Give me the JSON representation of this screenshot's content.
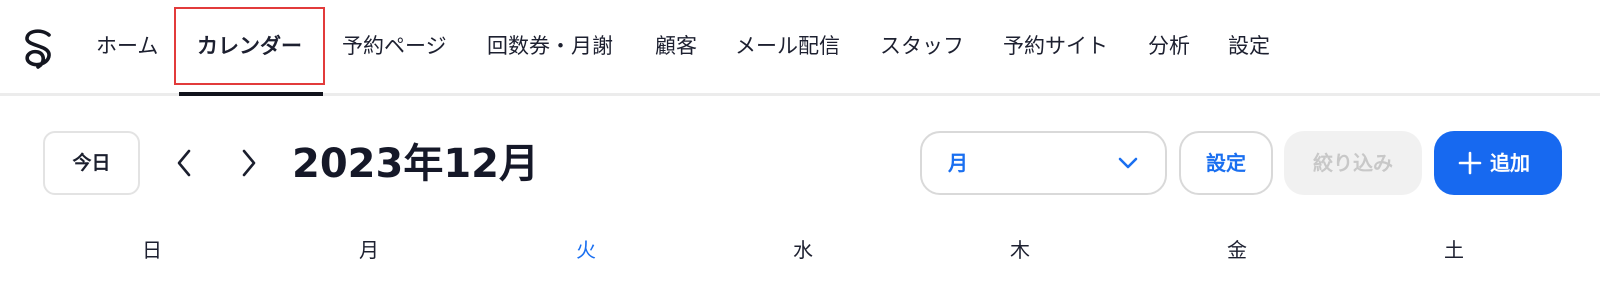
{
  "nav": {
    "items": [
      {
        "label": "ホーム"
      },
      {
        "label": "カレンダー",
        "active": true
      },
      {
        "label": "予約ページ"
      },
      {
        "label": "回数券・月謝"
      },
      {
        "label": "顧客"
      },
      {
        "label": "メール配信"
      },
      {
        "label": "スタッフ"
      },
      {
        "label": "予約サイト"
      },
      {
        "label": "分析"
      },
      {
        "label": "設定"
      }
    ]
  },
  "toolbar": {
    "today_label": "今日",
    "month_title": "2023年12月",
    "view_select_value": "月",
    "settings_label": "設定",
    "filter_label": "絞り込み",
    "add_label": "追加"
  },
  "weekdays": [
    {
      "label": "日"
    },
    {
      "label": "月"
    },
    {
      "label": "火",
      "highlighted": true
    },
    {
      "label": "水"
    },
    {
      "label": "木"
    },
    {
      "label": "金"
    },
    {
      "label": "土"
    }
  ],
  "colors": {
    "accent": "#1769f0",
    "highlight_day": "#1a6ff0",
    "active_outline": "#e23b3b"
  },
  "icons": [
    "logo-icon",
    "chevron-left-icon",
    "chevron-right-icon",
    "chevron-down-icon",
    "plus-icon"
  ]
}
